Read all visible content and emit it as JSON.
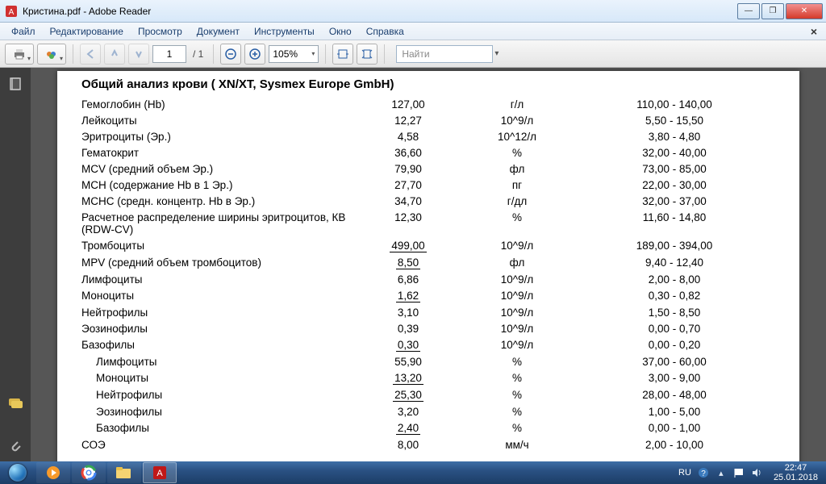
{
  "window": {
    "title": "Кристина.pdf - Adobe Reader"
  },
  "menu": {
    "items": [
      "Файл",
      "Редактирование",
      "Просмотр",
      "Документ",
      "Инструменты",
      "Окно",
      "Справка"
    ]
  },
  "toolbar": {
    "page_current": "1",
    "page_total": "/ 1",
    "zoom": "105%",
    "find_placeholder": "Найти"
  },
  "doc": {
    "title": "Общий анализ крови ( XN/XT, Sysmex  Europe GmbH)",
    "rows": [
      {
        "name": "Гемоглобин (Hb)",
        "val": "127,00",
        "unit": "г/л",
        "range": "110,00 - 140,00",
        "u": false,
        "indent": false
      },
      {
        "name": "Лейкоциты",
        "val": "12,27",
        "unit": "10^9/л",
        "range": "5,50 - 15,50",
        "u": false,
        "indent": false
      },
      {
        "name": "Эритроциты (Эр.)",
        "val": "4,58",
        "unit": "10^12/л",
        "range": "3,80 - 4,80",
        "u": false,
        "indent": false
      },
      {
        "name": "Гематокрит",
        "val": "36,60",
        "unit": "%",
        "range": "32,00 - 40,00",
        "u": false,
        "indent": false
      },
      {
        "name": "MCV (средний объем Эр.)",
        "val": "79,90",
        "unit": "фл",
        "range": "73,00 - 85,00",
        "u": false,
        "indent": false
      },
      {
        "name": "MCH (содержание Hb в 1 Эр.)",
        "val": "27,70",
        "unit": "пг",
        "range": "22,00 - 30,00",
        "u": false,
        "indent": false
      },
      {
        "name": "MCHC (средн. концентр. Hb в Эр.)",
        "val": "34,70",
        "unit": "г/дл",
        "range": "32,00 - 37,00",
        "u": false,
        "indent": false
      },
      {
        "name": "Расчетное распределение ширины эритроцитов, КВ (RDW-CV)",
        "val": "12,30",
        "unit": "%",
        "range": "11,60 - 14,80",
        "u": false,
        "indent": false
      },
      {
        "name": "Тромбоциты",
        "val": "499,00",
        "unit": "10^9/л",
        "range": "189,00 - 394,00",
        "u": true,
        "indent": false
      },
      {
        "name": "MPV (средний объем тромбоцитов)",
        "val": "8,50",
        "unit": "фл",
        "range": "9,40 - 12,40",
        "u": true,
        "indent": false
      },
      {
        "name": "Лимфоциты",
        "val": "6,86",
        "unit": "10^9/л",
        "range": "2,00 - 8,00",
        "u": false,
        "indent": false
      },
      {
        "name": "Моноциты",
        "val": "1,62",
        "unit": "10^9/л",
        "range": "0,30 - 0,82",
        "u": true,
        "indent": false
      },
      {
        "name": "Нейтрофилы",
        "val": "3,10",
        "unit": "10^9/л",
        "range": "1,50 - 8,50",
        "u": false,
        "indent": false
      },
      {
        "name": "Эозинофилы",
        "val": "0,39",
        "unit": "10^9/л",
        "range": "0,00 - 0,70",
        "u": false,
        "indent": false
      },
      {
        "name": "Базофилы",
        "val": "0,30",
        "unit": "10^9/л",
        "range": "0,00 - 0,20",
        "u": true,
        "indent": false
      },
      {
        "name": "Лимфоциты",
        "val": "55,90",
        "unit": "%",
        "range": "37,00 - 60,00",
        "u": false,
        "indent": true
      },
      {
        "name": "Моноциты",
        "val": "13,20",
        "unit": "%",
        "range": "3,00 - 9,00",
        "u": true,
        "indent": true
      },
      {
        "name": "Нейтрофилы",
        "val": "25,30",
        "unit": "%",
        "range": "28,00 - 48,00",
        "u": true,
        "indent": true
      },
      {
        "name": "Эозинофилы",
        "val": "3,20",
        "unit": "%",
        "range": "1,00 - 5,00",
        "u": false,
        "indent": true
      },
      {
        "name": "Базофилы",
        "val": "2,40",
        "unit": "%",
        "range": "0,00 - 1,00",
        "u": true,
        "indent": true
      },
      {
        "name": "СОЭ",
        "val": "8,00",
        "unit": "мм/ч",
        "range": "2,00 - 10,00",
        "u": false,
        "indent": false
      }
    ]
  },
  "tray": {
    "lang": "RU",
    "time": "22:47",
    "date": "25.01.2018"
  }
}
